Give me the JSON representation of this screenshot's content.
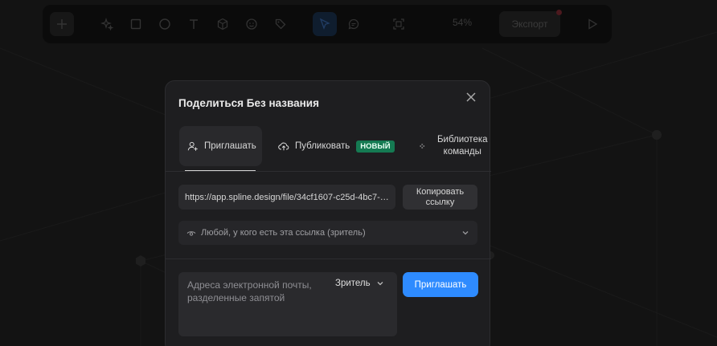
{
  "toolbar": {
    "zoom": "54%",
    "export_label": "Экспорт",
    "tools": [
      {
        "icon": "plus-icon"
      },
      {
        "icon": "sparkle-icon"
      },
      {
        "icon": "rectangle-icon"
      },
      {
        "icon": "ellipse-icon"
      },
      {
        "icon": "text-icon"
      },
      {
        "icon": "cube-icon"
      },
      {
        "icon": "emoji-icon"
      },
      {
        "icon": "tag-icon"
      },
      {
        "icon": "cursor-icon"
      },
      {
        "icon": "comment-icon"
      },
      {
        "icon": "frame-icon"
      },
      {
        "icon": "play-icon"
      }
    ]
  },
  "modal": {
    "title": "Поделиться Без названия",
    "tabs": {
      "invite": "Приглашать",
      "publish": "Публиковать",
      "publish_badge": "НОВЫЙ",
      "library": "Библиотека команды"
    },
    "share_link": "https://app.spline.design/file/34cf1607-c25d-4bc7-…",
    "copy_button": "Копировать ссылку",
    "access": "Любой, у кого есть эта ссылка (зритель)",
    "email_placeholder": "Адреса электронной почты, разделенные запятой",
    "role": "Зритель",
    "invite_button": "Приглашать"
  },
  "colors": {
    "accent": "#2e8bff",
    "badge": "#157a52",
    "modal_bg": "#1e1e20",
    "canvas_bg": "#232323"
  }
}
